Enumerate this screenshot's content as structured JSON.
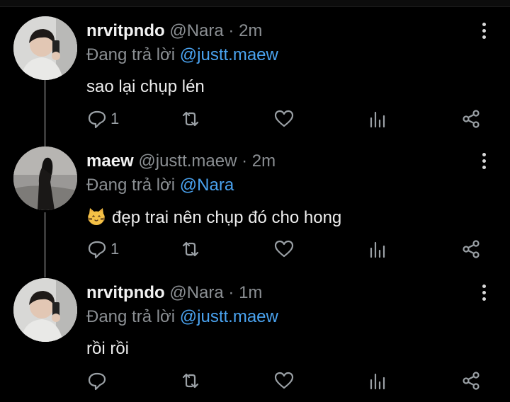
{
  "tweets": [
    {
      "name": "nrvitpndo",
      "handle": "@Nara",
      "dot": "·",
      "time": "2m",
      "replying_prefix": "Đang trả lời",
      "replying_to": "@justt.maew",
      "text": "sao lại chụp lén",
      "reply_count": "1",
      "avatar": "boy-mirror-selfie"
    },
    {
      "name": "maew",
      "handle": "@justt.maew",
      "dot": "·",
      "time": "2m",
      "replying_prefix": "Đang trả lời",
      "replying_to": "@Nara",
      "text": "đẹp trai nên chụp đó cho hong",
      "emoji": "cat-face-emoji",
      "reply_count": "1",
      "avatar": "girl-silhouette"
    },
    {
      "name": "nrvitpndo",
      "handle": "@Nara",
      "dot": "·",
      "time": "1m",
      "replying_prefix": "Đang trả lời",
      "replying_to": "@justt.maew",
      "text": "rồi rồi",
      "reply_count": "",
      "avatar": "boy-mirror-selfie"
    }
  ],
  "icons": {
    "reply": "reply-icon",
    "retweet": "retweet-icon",
    "like": "heart-icon",
    "analytics": "analytics-icon",
    "share": "share-icon",
    "more": "more-vertical-icon"
  },
  "colors": {
    "background": "#000000",
    "mention": "#4aa3f0",
    "secondary_text": "#8b8f93"
  }
}
